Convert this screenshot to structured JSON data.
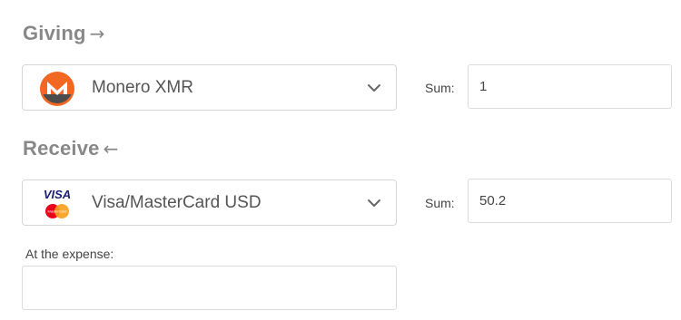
{
  "giving": {
    "title": "Giving",
    "arrow": "→",
    "currency": {
      "label": "Monero XMR",
      "icon": "monero-icon",
      "brand_colors": [
        "#f26822",
        "#4c4c4c"
      ]
    },
    "sum_label": "Sum:",
    "sum_value": "1"
  },
  "receive": {
    "title": "Receive",
    "arrow": "←",
    "currency": {
      "label": "Visa/MasterCard USD",
      "icon": "visa-mastercard-icon",
      "visa_text": "VISA",
      "mastercard_text": "MasterCard",
      "brand_colors": [
        "#1a1f71",
        "#eb001b",
        "#f79e1b"
      ]
    },
    "sum_label": "Sum:",
    "sum_value": "50.2"
  },
  "expense": {
    "label": "At the expense:",
    "value": ""
  },
  "colors": {
    "title": "#888888",
    "border": "#d6d6d6",
    "text": "#444444"
  }
}
